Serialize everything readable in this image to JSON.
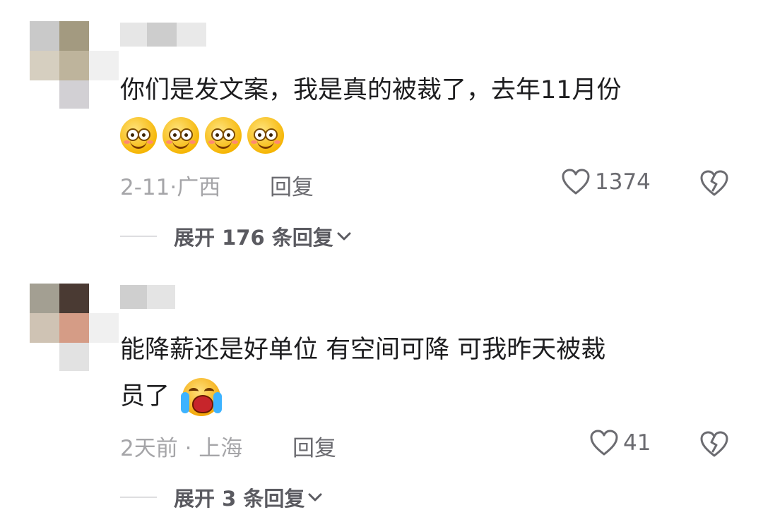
{
  "comments": [
    {
      "text_lines": [
        "你们是发文案，我是真的被裁了，去年11月份"
      ],
      "emojis": [
        "smile-emoji",
        "smile-emoji",
        "smile-emoji",
        "smile-emoji"
      ],
      "date": "2-11·",
      "location": "广西",
      "reply_label": "回复",
      "likes": "1374",
      "expand_label": "展开 176 条回复",
      "avatar_colors": [
        "#c9c9c9",
        "#a39a80",
        "#eeeeee",
        "#d6cfc0",
        "#beb49c",
        "#f0f0f0",
        "#e9e9e9",
        "#d2d0d4",
        "#ffffff"
      ],
      "username_colors": [
        "#dddddd",
        "#c6c6c6",
        "#ececec"
      ]
    },
    {
      "text_lines": [
        "能降薪还是好单位  有空间可降  可我昨天被裁",
        "员了"
      ],
      "emojis": [
        "crying-emoji"
      ],
      "date": "2天前 · ",
      "location": "上海",
      "reply_label": "回复",
      "likes": "41",
      "expand_label": "展开 3 条回复",
      "avatar_colors": [
        "#a39f92",
        "#4a3a33",
        "#eeeeee",
        "#cfc3b4",
        "#d59c86",
        "#f0f0f0",
        "#ebebeb",
        "#dedede",
        "#ffffff"
      ],
      "username_colors": [
        "#cfcfcf",
        "#e4e4e4",
        "#f0f0f0"
      ]
    }
  ],
  "icons": {
    "like": "heart-outline-icon",
    "dislike": "broken-heart-icon",
    "expand": "chevron-down-icon"
  }
}
